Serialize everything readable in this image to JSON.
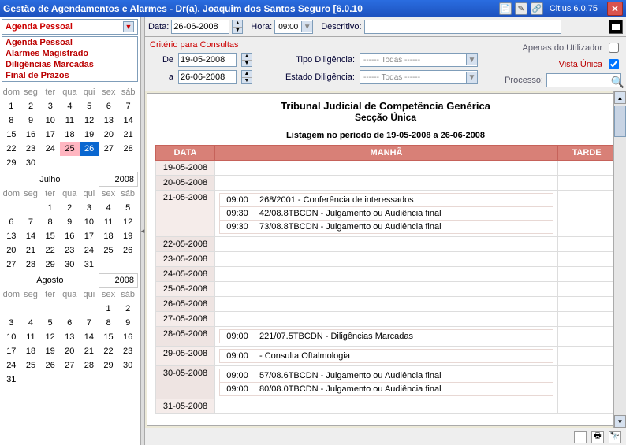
{
  "window": {
    "title": "Gestão de Agendamentos e Alarmes - Dr(a). Joaquim dos Santos Seguro [6.0.10",
    "citius": "Citius 6.0.75"
  },
  "sidebar": {
    "dropdown": "Agenda Pessoal",
    "items": [
      "Agenda Pessoal",
      "Alarmes Magistrado",
      "Diligências Marcadas",
      "Final de Prazos"
    ],
    "calendars": [
      {
        "month": "",
        "year": "",
        "headers": [
          "dom",
          "seg",
          "ter",
          "qua",
          "qui",
          "sex",
          "sáb"
        ],
        "weeks": [
          [
            "1",
            "2",
            "3",
            "4",
            "5",
            "6",
            "7"
          ],
          [
            "8",
            "9",
            "10",
            "11",
            "12",
            "13",
            "14"
          ],
          [
            "15",
            "16",
            "17",
            "18",
            "19",
            "20",
            "21"
          ],
          [
            "22",
            "23",
            "24",
            "25",
            "26",
            "27",
            "28"
          ],
          [
            "29",
            "30",
            "",
            "",
            "",
            "",
            ""
          ]
        ],
        "highlights": {
          "pink": "25",
          "blue": "26"
        }
      },
      {
        "month": "Julho",
        "year": "2008",
        "headers": [
          "dom",
          "seg",
          "ter",
          "qua",
          "qui",
          "sex",
          "sáb"
        ],
        "weeks": [
          [
            "",
            "",
            "1",
            "2",
            "3",
            "4",
            "5"
          ],
          [
            "6",
            "7",
            "8",
            "9",
            "10",
            "11",
            "12"
          ],
          [
            "13",
            "14",
            "15",
            "16",
            "17",
            "18",
            "19"
          ],
          [
            "20",
            "21",
            "22",
            "23",
            "24",
            "25",
            "26"
          ],
          [
            "27",
            "28",
            "29",
            "30",
            "31",
            "",
            ""
          ]
        ]
      },
      {
        "month": "Agosto",
        "year": "2008",
        "headers": [
          "dom",
          "seg",
          "ter",
          "qua",
          "qui",
          "sex",
          "sáb"
        ],
        "weeks": [
          [
            "",
            "",
            "",
            "",
            "",
            "1",
            "2"
          ],
          [
            "3",
            "4",
            "5",
            "6",
            "7",
            "8",
            "9"
          ],
          [
            "10",
            "11",
            "12",
            "13",
            "14",
            "15",
            "16"
          ],
          [
            "17",
            "18",
            "19",
            "20",
            "21",
            "22",
            "23"
          ],
          [
            "24",
            "25",
            "26",
            "27",
            "28",
            "29",
            "30"
          ],
          [
            "31",
            "",
            "",
            "",
            "",
            "",
            ""
          ]
        ]
      }
    ]
  },
  "toolbar": {
    "data_label": "Data:",
    "data_value": "26-06-2008",
    "hora_label": "Hora:",
    "hora_value": "09:00",
    "descritivo_label": "Descritivo:",
    "descritivo_value": ""
  },
  "criteria": {
    "title": "Critério para Consultas",
    "de_label": "De",
    "de_value": "19-05-2008",
    "a_label": "a",
    "a_value": "26-06-2008",
    "tipo_label": "Tipo Diligência:",
    "tipo_value": "------ Todas ------",
    "estado_label": "Estado Diligência:",
    "estado_value": "------ Todas ------",
    "apenas_label": "Apenas do Utilizador",
    "apenas_checked": false,
    "vista_label": "Vista Única",
    "vista_checked": true,
    "processo_label": "Processo:",
    "processo_value": ""
  },
  "content": {
    "court": "Tribunal Judicial de Competência Genérica",
    "section": "Secção Única",
    "period": "Listagem no período de 19-05-2008 a 26-06-2008",
    "headers": {
      "data": "DATA",
      "manha": "MANHÃ",
      "tarde": "TARDE"
    },
    "rows": [
      {
        "date": "19-05-2008",
        "morning": [],
        "afternoon": []
      },
      {
        "date": "20-05-2008",
        "morning": [],
        "afternoon": []
      },
      {
        "date": "21-05-2008",
        "morning": [
          {
            "time": "09:00",
            "text": "268/2001 - Conferência de interessados"
          },
          {
            "time": "09:30",
            "text": "42/08.8TBCDN - Julgamento ou Audiência final"
          },
          {
            "time": "09:30",
            "text": "73/08.8TBCDN - Julgamento ou Audiência final"
          }
        ],
        "afternoon": []
      },
      {
        "date": "22-05-2008",
        "morning": [],
        "afternoon": []
      },
      {
        "date": "23-05-2008",
        "morning": [],
        "afternoon": []
      },
      {
        "date": "24-05-2008",
        "morning": [],
        "afternoon": []
      },
      {
        "date": "25-05-2008",
        "morning": [],
        "afternoon": []
      },
      {
        "date": "26-05-2008",
        "morning": [],
        "afternoon": []
      },
      {
        "date": "27-05-2008",
        "morning": [],
        "afternoon": []
      },
      {
        "date": "28-05-2008",
        "morning": [
          {
            "time": "09:00",
            "text": "221/07.5TBCDN - Diligências Marcadas"
          }
        ],
        "afternoon": []
      },
      {
        "date": "29-05-2008",
        "morning": [
          {
            "time": "09:00",
            "text": "- Consulta Oftalmologia"
          }
        ],
        "afternoon": []
      },
      {
        "date": "30-05-2008",
        "morning": [
          {
            "time": "09:00",
            "text": "57/08.6TBCDN - Julgamento ou Audiência final"
          },
          {
            "time": "09:00",
            "text": "80/08.0TBCDN - Julgamento ou Audiência final"
          }
        ],
        "afternoon": []
      },
      {
        "date": "31-05-2008",
        "morning": [],
        "afternoon": []
      }
    ]
  }
}
